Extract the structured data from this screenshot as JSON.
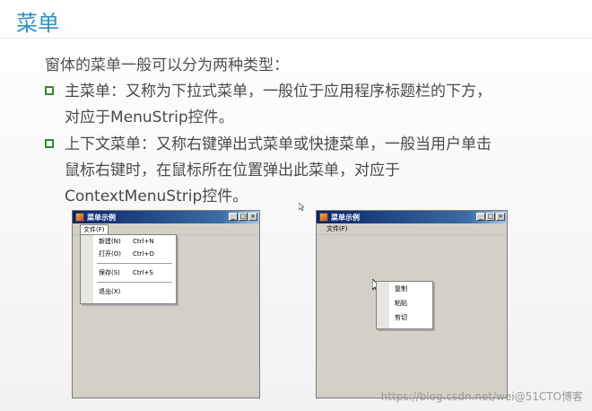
{
  "slide": {
    "title": "菜单",
    "intro": "窗体的菜单一般可以分为两种类型：",
    "bullets": [
      {
        "line1": "主菜单：又称为下拉式菜单，一般位于应用程序标题栏的下方，",
        "line2": "对应于MenuStrip控件。"
      },
      {
        "line1": "上下文菜单：又称右键弹出式菜单或快捷菜单，一般当用户单击",
        "line2": "鼠标右键时，在鼠标所在位置弹出此菜单，对应于",
        "line3": "ContextMenuStrip控件。"
      }
    ]
  },
  "window1": {
    "title": "菜单示例",
    "menubar": [
      "文件(F)"
    ],
    "menu_items": [
      {
        "label": "新建(N)",
        "shortcut": "Ctrl+N"
      },
      {
        "label": "打开(O)",
        "shortcut": "Ctrl+O"
      },
      {
        "label": "保存(S)",
        "shortcut": "Ctrl+S"
      },
      {
        "label": "退出(X)",
        "shortcut": ""
      }
    ]
  },
  "window2": {
    "title": "菜单示例",
    "menubar": [
      "文件(F)"
    ],
    "context_items": [
      "复制",
      "粘贴",
      "剪切"
    ]
  },
  "watermark": "https://blog.csdn.net/wei@51CTO博客",
  "colors": {
    "title": "#2e8fc4",
    "bullet_box": "#2f8a2f",
    "titlebar": "#0a246a"
  }
}
